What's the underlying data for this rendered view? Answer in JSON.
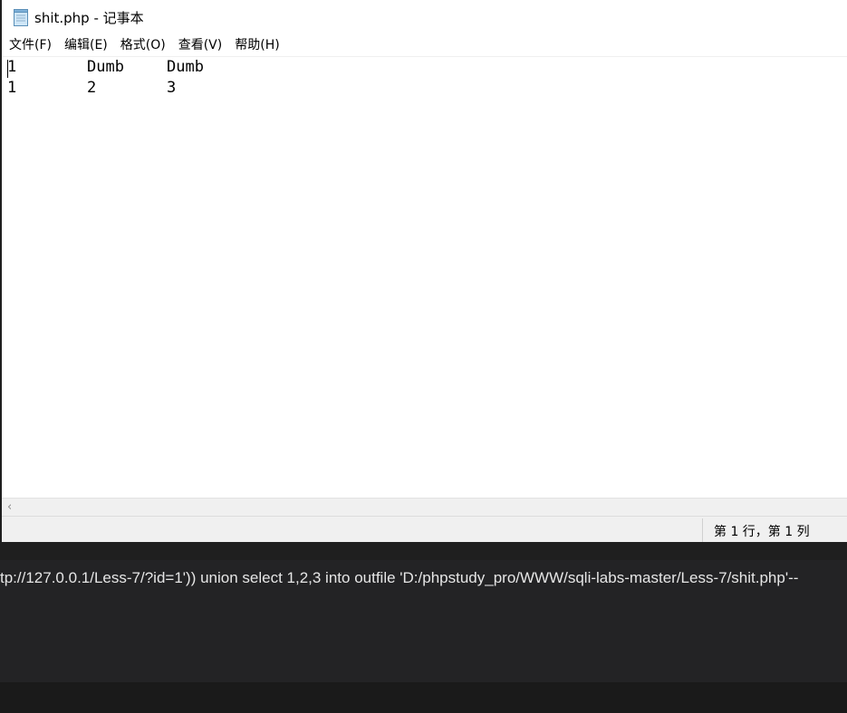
{
  "window": {
    "title": "shit.php - 记事本"
  },
  "menu": [
    {
      "label": "文件(F)"
    },
    {
      "label": "编辑(E)"
    },
    {
      "label": "格式(O)"
    },
    {
      "label": "查看(V)"
    },
    {
      "label": "帮助(H)"
    }
  ],
  "editor": {
    "rows": [
      [
        "1",
        "Dumb",
        "Dumb"
      ],
      [
        "1",
        "2",
        "3"
      ]
    ]
  },
  "statusbar": {
    "position": "第 1 行，第 1 列"
  },
  "terminal": {
    "url": "tp://127.0.0.1/Less-7/?id=1')) union select 1,2,3 into outfile 'D:/phpstudy_pro/WWW/sqli-labs-master/Less-7/shit.php'--"
  },
  "colors": {
    "notepad_bg": "#ffffff",
    "chrome_bg": "#f0f0f0",
    "dark_panel": "#1f1f1f",
    "url_panel": "#232325"
  },
  "icons": {
    "app": "notepad-icon",
    "scroll": "chevron-left-icon"
  }
}
